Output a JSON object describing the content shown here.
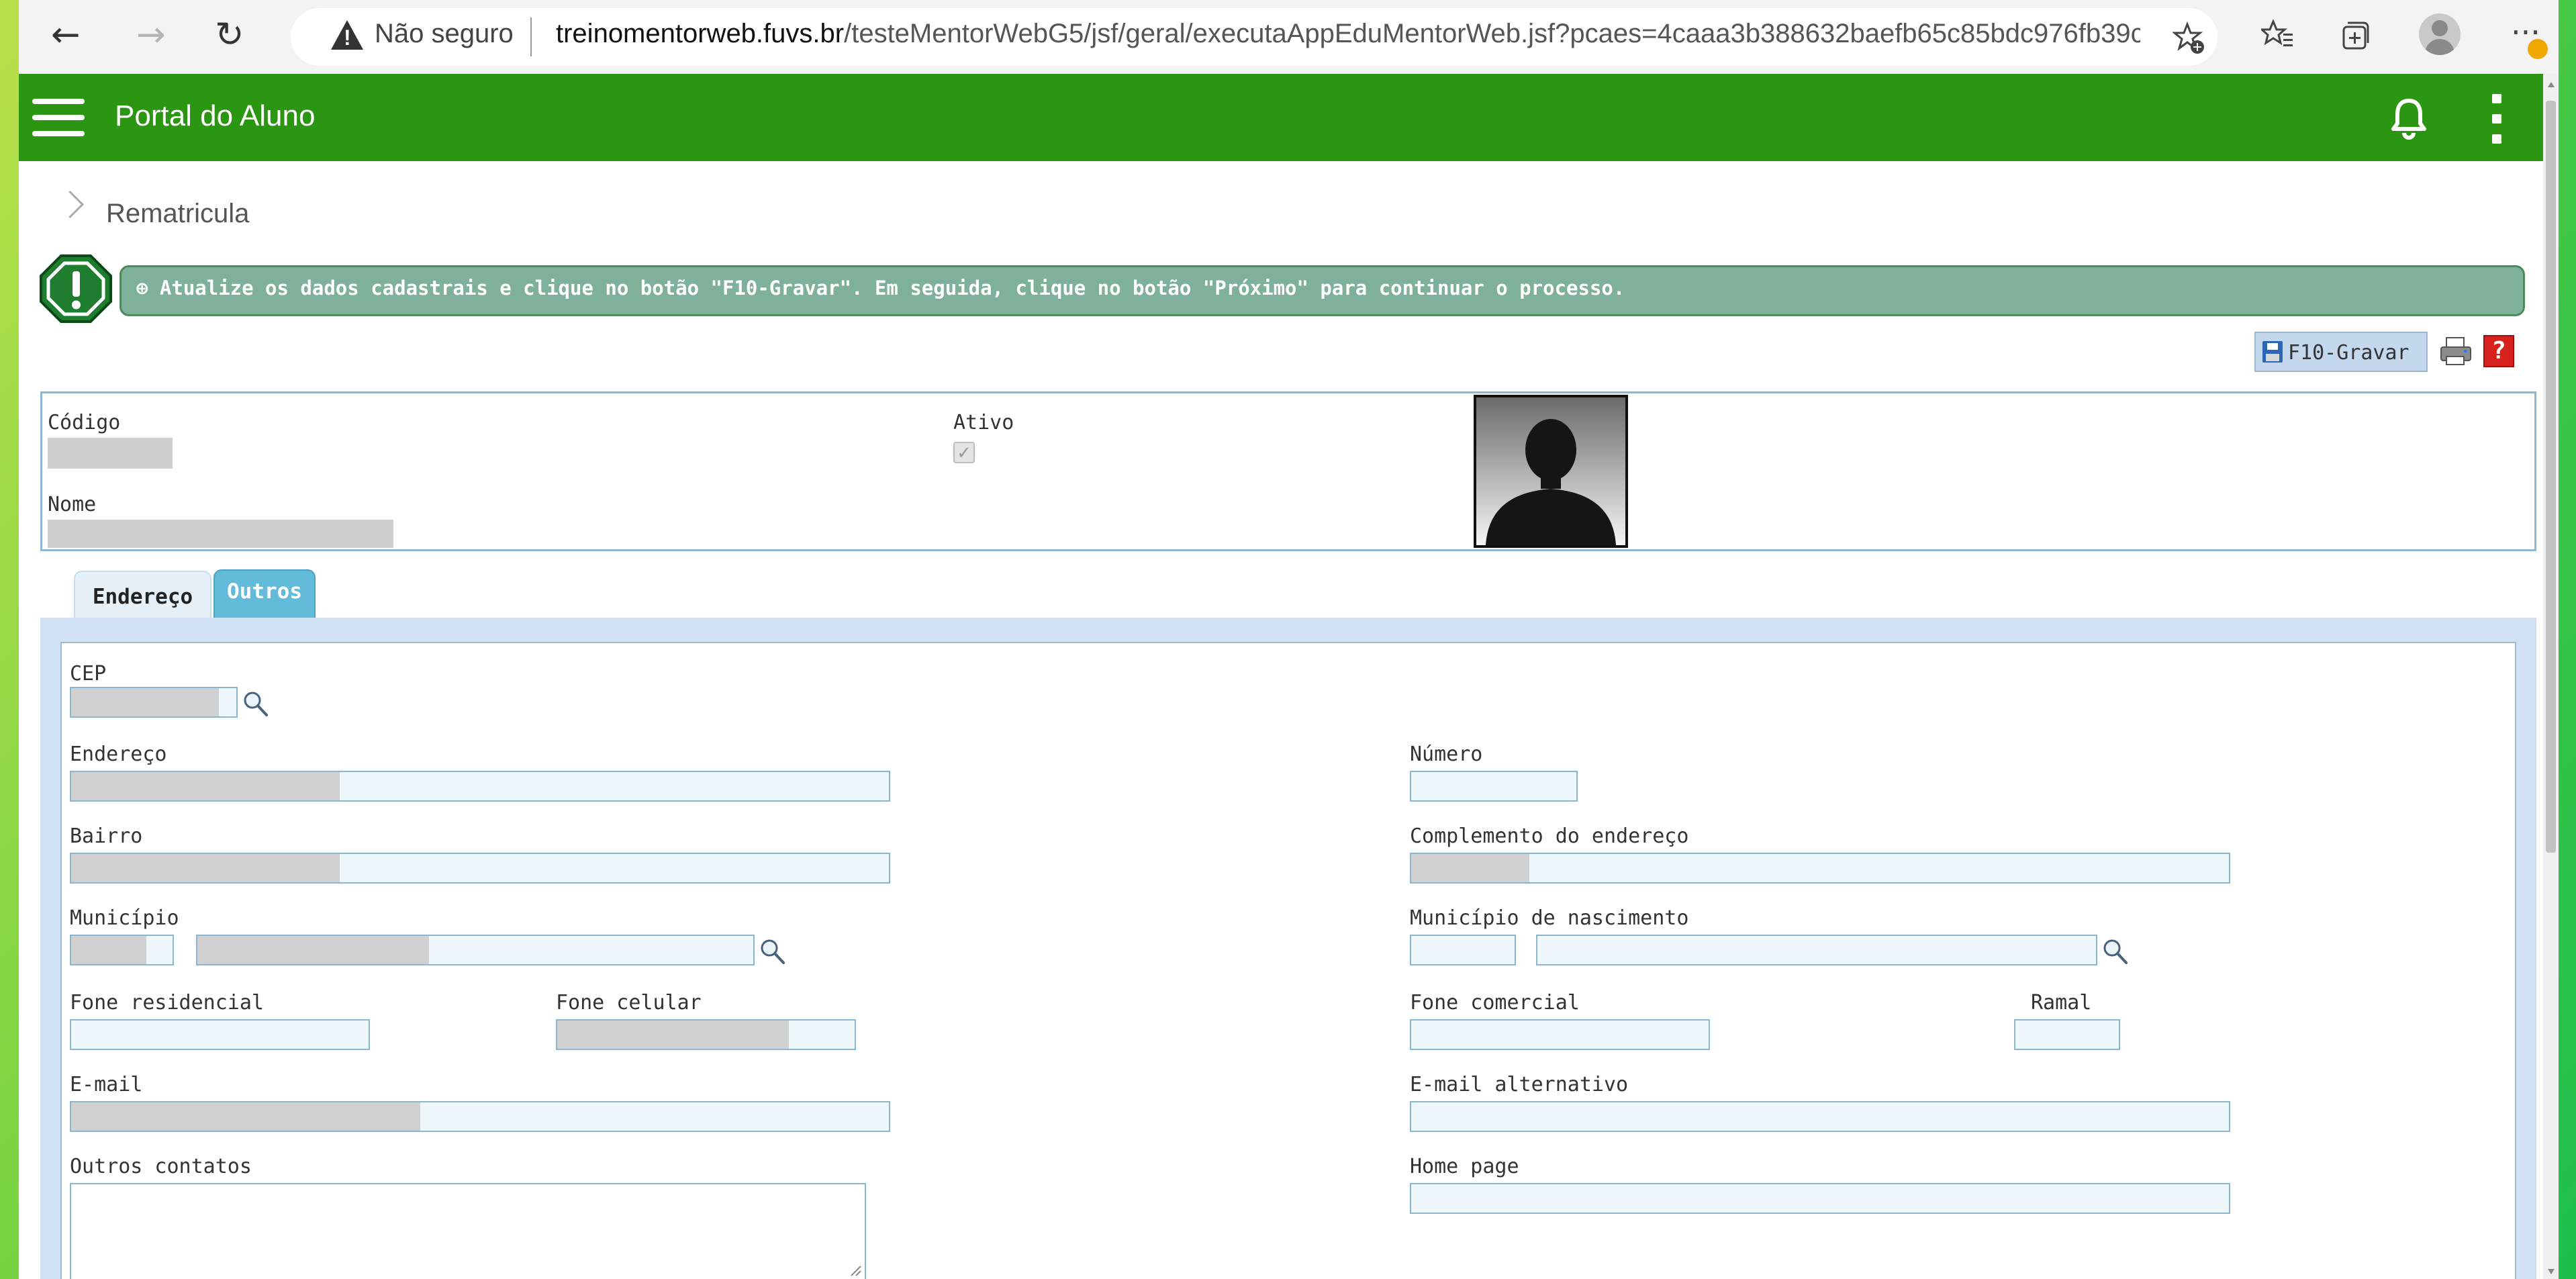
{
  "browser": {
    "security_label": "Não seguro",
    "url_host": "treinomentorweb.fuvs.br",
    "url_path": "/testeMentorWebG5/jsf/geral/executaAppEduMentorWeb.jsf?pcaes=4caaa3b388632baefb65c85bdc976fb39c03..."
  },
  "header": {
    "title": "Portal do Aluno"
  },
  "breadcrumb": {
    "label": "Rematricula"
  },
  "alert": {
    "message": "⊕ Atualize os dados cadastrais e clique no botão \"F10-Gravar\". Em seguida, clique no botão \"Próximo\" para continuar o processo."
  },
  "toolbar": {
    "save_label": "F10-Gravar",
    "help_label": "?"
  },
  "student": {
    "codigo_label": "Código",
    "nome_label": "Nome",
    "ativo_label": "Ativo",
    "ativo_checked": true
  },
  "tabs": [
    {
      "label": "Endereço",
      "active": true
    },
    {
      "label": "Outros",
      "active": false
    }
  ],
  "form": {
    "cep": "CEP",
    "endereco": "Endereço",
    "numero": "Número",
    "bairro": "Bairro",
    "complemento": "Complemento do endereço",
    "municipio": "Município",
    "municipio_nasc": "Município de nascimento",
    "fone_res": "Fone residencial",
    "fone_cel": "Fone celular",
    "fone_com": "Fone comercial",
    "ramal": "Ramal",
    "email": "E-mail",
    "email_alt": "E-mail alternativo",
    "outros_contatos": "Outros contatos",
    "home_page": "Home page"
  },
  "colors": {
    "header_green": "#2b9612",
    "alert_bg": "#7fb19a",
    "tab_active": "#62bcd9",
    "panel_bg": "#cfe1f2",
    "help_red": "#d6211c"
  }
}
